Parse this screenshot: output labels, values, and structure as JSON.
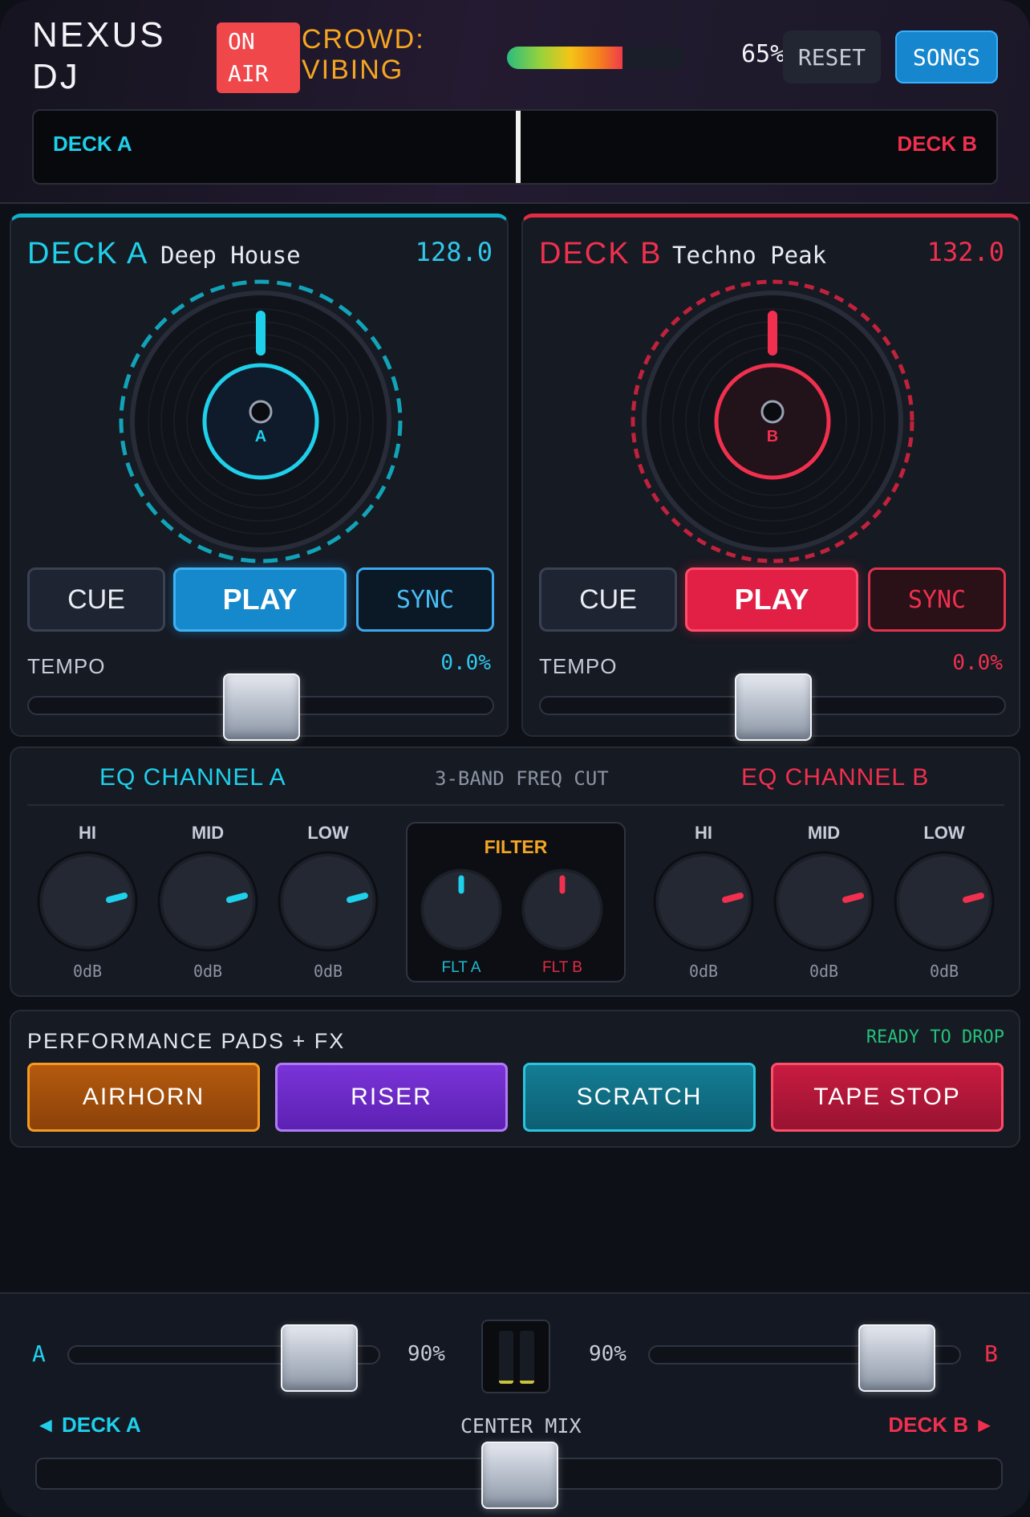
{
  "header": {
    "brand": "NEXUS\nDJ",
    "on_air": "ON\nAIR",
    "crowd": "CROWD:\nVIBING",
    "energy_percent": 65,
    "energy_label": "65%",
    "reset_label": "RESET",
    "songs_label": "SONGS",
    "overview_deck_a": "DECK A",
    "overview_deck_b": "DECK B"
  },
  "deck_a": {
    "title": "DECK A",
    "genre": "Deep House",
    "bpm": "128.0",
    "platter_letter": "A",
    "cue_label": "CUE",
    "play_label": "PLAY",
    "sync_label": "SYNC",
    "tempo_label": "TEMPO",
    "tempo_value": "0.0%",
    "color": "#1fd0ea"
  },
  "deck_b": {
    "title": "DECK B",
    "genre": "Techno Peak",
    "bpm": "132.0",
    "platter_letter": "B",
    "cue_label": "CUE",
    "play_label": "PLAY",
    "sync_label": "SYNC",
    "tempo_label": "TEMPO",
    "tempo_value": "0.0%",
    "color": "#f0304e"
  },
  "eq": {
    "channel_a_title": "EQ CHANNEL A",
    "center_title": "3-BAND FREQ CUT",
    "channel_b_title": "EQ CHANNEL B",
    "channel_a": [
      {
        "label": "HI",
        "value": "0dB"
      },
      {
        "label": "MID",
        "value": "0dB"
      },
      {
        "label": "LOW",
        "value": "0dB"
      }
    ],
    "channel_b": [
      {
        "label": "HI",
        "value": "0dB"
      },
      {
        "label": "MID",
        "value": "0dB"
      },
      {
        "label": "LOW",
        "value": "0dB"
      }
    ],
    "filter_title": "FILTER",
    "filter_a_label": "FLT A",
    "filter_b_label": "FLT B"
  },
  "pads": {
    "title": "PERFORMANCE PADS + FX",
    "status": "READY TO DROP",
    "items": [
      "AIRHORN",
      "RISER",
      "SCRATCH",
      "TAPE STOP"
    ]
  },
  "mixer": {
    "channel_a_letter": "A",
    "channel_b_letter": "B",
    "volume_a": "90%",
    "volume_b": "90%",
    "crossfader_left": "◄ DECK A",
    "crossfader_center": "CENTER MIX",
    "crossfader_right": "DECK B ►"
  }
}
